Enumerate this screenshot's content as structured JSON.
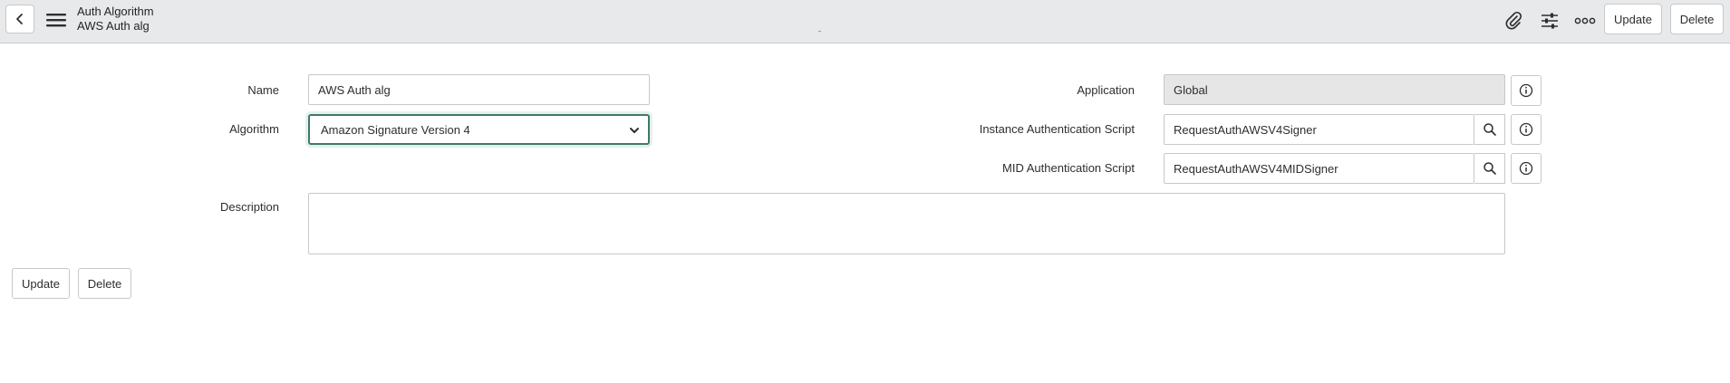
{
  "header": {
    "table_name": "Auth Algorithm",
    "record_name": "AWS Auth alg",
    "update_label": "Update",
    "delete_label": "Delete",
    "icons": [
      "chevron-left-icon",
      "menu-icon",
      "paperclip-icon",
      "sliders-icon",
      "more-icon"
    ]
  },
  "form": {
    "name_label": "Name",
    "name_value": "AWS Auth alg",
    "algorithm_label": "Algorithm",
    "algorithm_value": "Amazon Signature Version 4",
    "description_label": "Description",
    "description_value": "",
    "application_label": "Application",
    "application_value": "Global",
    "instance_script_label": "Instance Authentication Script",
    "instance_script_value": "RequestAuthAWSV4Signer",
    "mid_script_label": "MID Authentication Script",
    "mid_script_value": "RequestAuthAWSV4MIDSigner"
  },
  "footer": {
    "update_label": "Update",
    "delete_label": "Delete"
  },
  "colors": {
    "header_bg": "#e8e9eb",
    "focus_border": "#3d7a6b",
    "readonly_bg": "#e6e6e6"
  }
}
